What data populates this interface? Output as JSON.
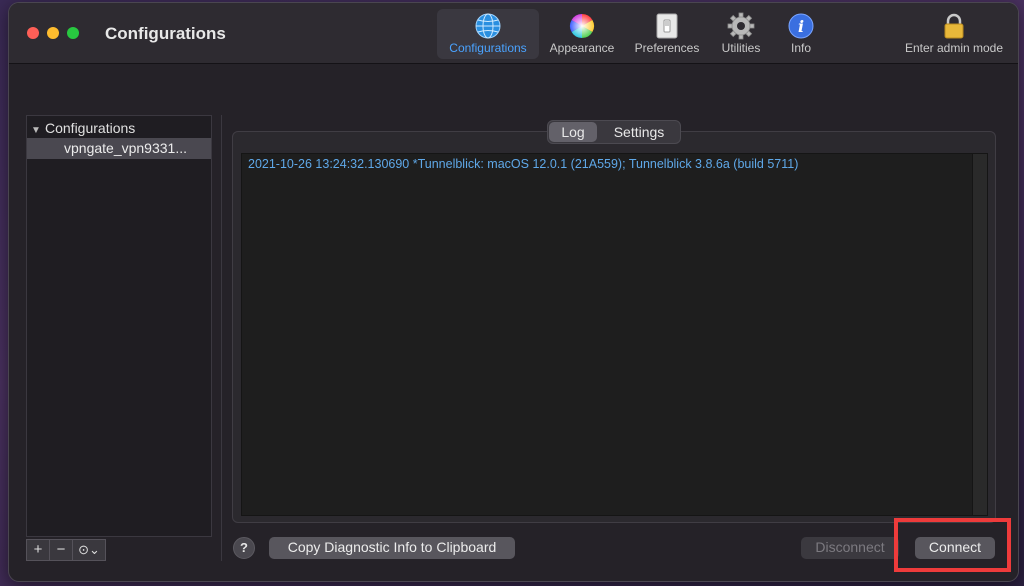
{
  "window": {
    "title": "Configurations"
  },
  "toolbar": {
    "items": [
      {
        "label": "Configurations",
        "icon": "globe-icon"
      },
      {
        "label": "Appearance",
        "icon": "color-wheel-icon"
      },
      {
        "label": "Preferences",
        "icon": "light-switch-icon"
      },
      {
        "label": "Utilities",
        "icon": "gear-icon"
      },
      {
        "label": "Info",
        "icon": "info-icon"
      }
    ],
    "admin_label": "Enter admin mode",
    "admin_icon": "lock-icon"
  },
  "sidebar": {
    "header": "Configurations",
    "items": [
      {
        "label": "vpngate_vpn9331..."
      }
    ],
    "tools": {
      "add": "+",
      "remove": "−",
      "actions": "⊙⌄"
    }
  },
  "tabs": {
    "log": "Log",
    "settings": "Settings",
    "selected": "Log"
  },
  "log": {
    "lines": [
      "2021-10-26 13:24:32.130690 *Tunnelblick: macOS 12.0.1 (21A559); Tunnelblick 3.8.6a (build 5711)"
    ]
  },
  "buttons": {
    "help": "?",
    "copy_diagnostic": "Copy Diagnostic Info to Clipboard",
    "disconnect": "Disconnect",
    "connect": "Connect"
  },
  "colors": {
    "accent": "#4aa3ff",
    "log_text": "#5fa8e8",
    "highlight": "#ee3b3b"
  }
}
